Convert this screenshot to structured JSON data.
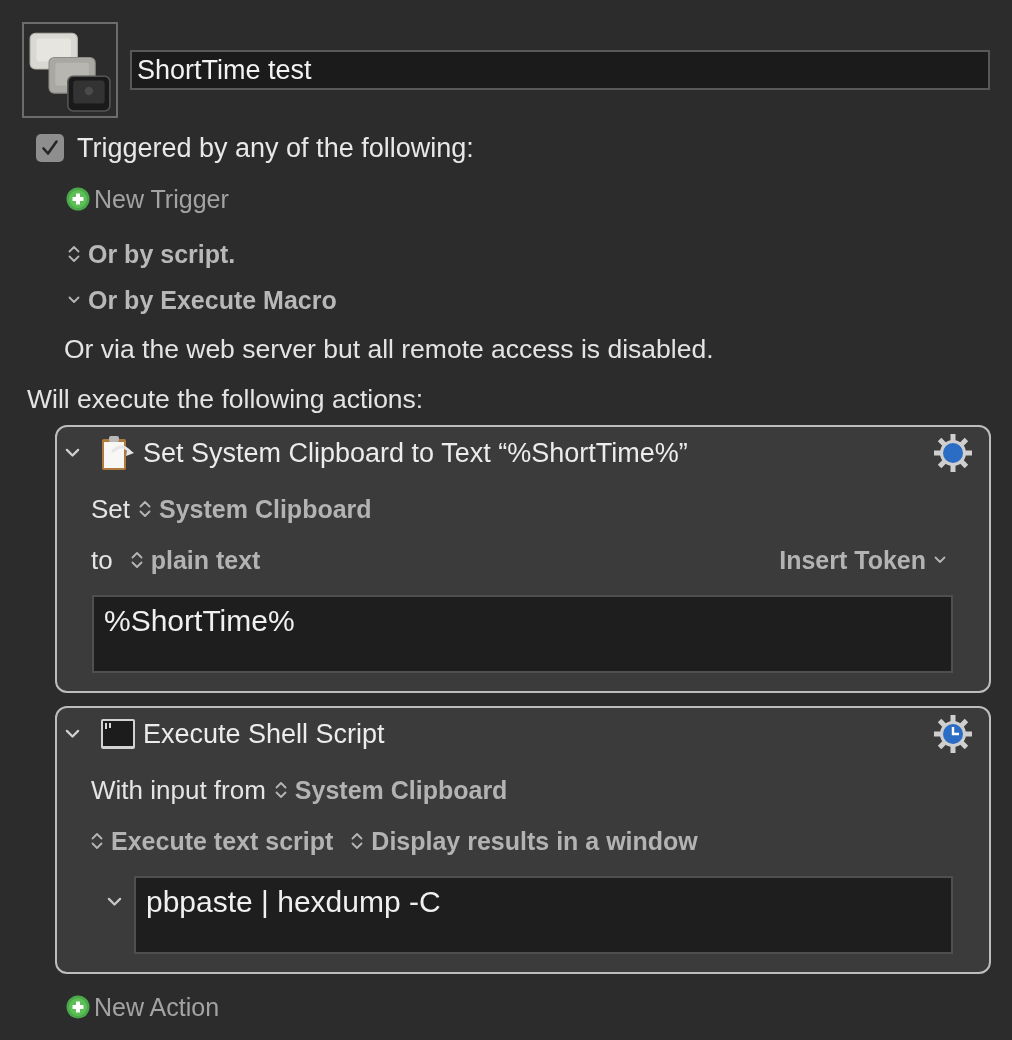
{
  "macro": {
    "name": "ShortTime test"
  },
  "triggers": {
    "checked": true,
    "label": "Triggered by any of the following:",
    "new_trigger": "New Trigger",
    "options": [
      {
        "kind": "popup",
        "label": "Or by script."
      },
      {
        "kind": "menu",
        "label": "Or by Execute Macro"
      }
    ],
    "note": "Or via the web server but all remote access is disabled."
  },
  "actions_heading": "Will execute the following actions:",
  "actions": [
    {
      "kind": "clipboard",
      "expanded": true,
      "title": "Set System Clipboard to Text “%ShortTime%”",
      "rows": [
        [
          {
            "kind": "label",
            "text": "Set"
          },
          {
            "kind": "popup",
            "text": "System Clipboard"
          }
        ],
        [
          {
            "kind": "label",
            "text": "to"
          },
          {
            "kind": "popup",
            "text": "plain text"
          },
          {
            "kind": "menu",
            "text": "Insert Token"
          }
        ]
      ],
      "editor": {
        "kind": "text",
        "value": "%ShortTime%"
      }
    },
    {
      "kind": "shell",
      "expanded": true,
      "title": "Execute Shell Script",
      "rows": [
        [
          {
            "kind": "label",
            "text": "With input from"
          },
          {
            "kind": "popup",
            "text": "System Clipboard"
          }
        ],
        [
          {
            "kind": "popup",
            "text": "Execute text script"
          },
          {
            "kind": "popup",
            "text": "Display results in a window"
          }
        ]
      ],
      "editor": {
        "kind": "script",
        "expanded": true,
        "value": "pbpaste | hexdump -C"
      }
    }
  ],
  "new_action": "New Action"
}
